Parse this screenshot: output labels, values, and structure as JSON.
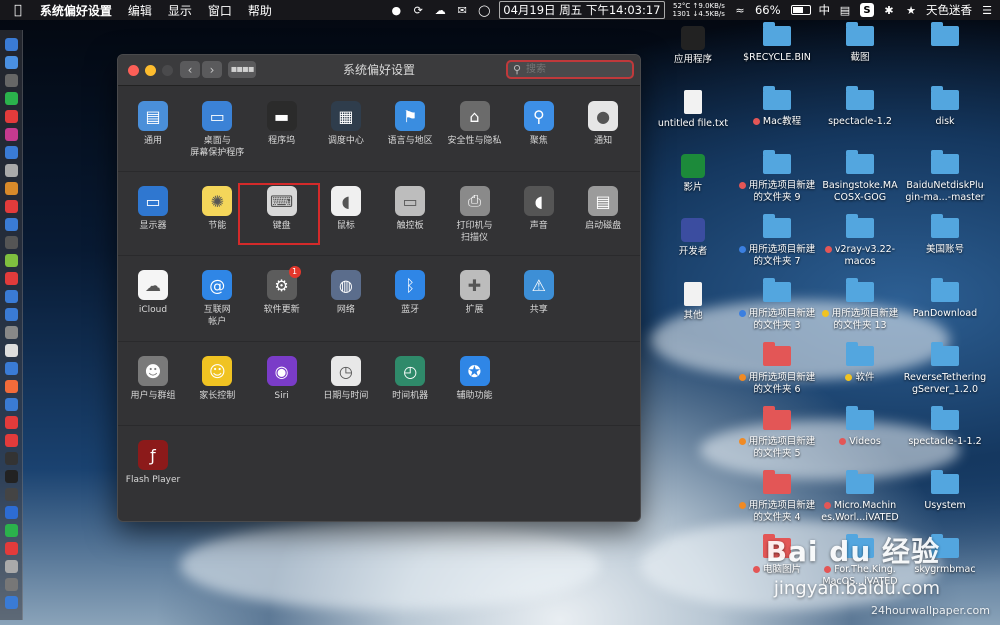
{
  "menubar": {
    "app_name": "系统偏好设置",
    "menus": [
      "编辑",
      "显示",
      "窗口",
      "帮助"
    ],
    "net_up": "52°C ↑9.0KB/s",
    "net_down": "1301 ↓4.5KB/s",
    "datetime": "04月19日 周五 下午14:03:17",
    "battery": "66%",
    "input_method": "中",
    "user": "天色迷香"
  },
  "window": {
    "title": "系统偏好设置",
    "search_placeholder": "搜索",
    "rows": [
      [
        {
          "label": "通用",
          "icon": "general-icon",
          "color": "#4a8fd9"
        },
        {
          "label": "桌面与\n屏幕保护程序",
          "icon": "desktop-icon",
          "color": "#3b82d6"
        },
        {
          "label": "程序坞",
          "icon": "dock-icon",
          "color": "#2b2b2b"
        },
        {
          "label": "调度中心",
          "icon": "mission-control-icon",
          "color": "#2f3d4c"
        },
        {
          "label": "语言与地区",
          "icon": "flag-icon",
          "color": "#3a8de0"
        },
        {
          "label": "安全性与隐私",
          "icon": "house-lock-icon",
          "color": "#6b6b6b"
        },
        {
          "label": "聚焦",
          "icon": "spotlight-icon",
          "color": "#3d8fe6"
        },
        {
          "label": "通知",
          "icon": "notifications-icon",
          "color": "#e6e6e6"
        }
      ],
      [
        {
          "label": "显示器",
          "icon": "display-icon",
          "color": "#2f77d0"
        },
        {
          "label": "节能",
          "icon": "bulb-icon",
          "color": "#f4d65a"
        },
        {
          "label": "键盘",
          "icon": "keyboard-icon",
          "color": "#d8d8d8"
        },
        {
          "label": "鼠标",
          "icon": "mouse-icon",
          "color": "#f0f0f0"
        },
        {
          "label": "触控板",
          "icon": "trackpad-icon",
          "color": "#bdbdbd"
        },
        {
          "label": "打印机与\n扫描仪",
          "icon": "printer-icon",
          "color": "#8a8a8a"
        },
        {
          "label": "声音",
          "icon": "speaker-icon",
          "color": "#555555"
        },
        {
          "label": "启动磁盘",
          "icon": "disk-icon",
          "color": "#9b9b9b"
        }
      ],
      [
        {
          "label": "iCloud",
          "icon": "icloud-icon",
          "color": "#f5f5f5"
        },
        {
          "label": "互联网\n帐户",
          "icon": "at-icon",
          "color": "#2f86e6"
        },
        {
          "label": "软件更新",
          "icon": "gear-update-icon",
          "color": "#5c5c5c",
          "badge": "1"
        },
        {
          "label": "网络",
          "icon": "network-globe-icon",
          "color": "#5b6d8c"
        },
        {
          "label": "蓝牙",
          "icon": "bluetooth-icon",
          "color": "#2f86e6"
        },
        {
          "label": "扩展",
          "icon": "puzzle-icon",
          "color": "#bcbcbc"
        },
        {
          "label": "共享",
          "icon": "sharing-folder-icon",
          "color": "#3d8fd6"
        }
      ],
      [
        {
          "label": "用户与群组",
          "icon": "users-icon",
          "color": "#7a7a7a"
        },
        {
          "label": "家长控制",
          "icon": "parental-icon",
          "color": "#f0c322"
        },
        {
          "label": "Siri",
          "icon": "siri-icon",
          "color": "#7a3cc8"
        },
        {
          "label": "日期与时间",
          "icon": "clock-calendar-icon",
          "color": "#e8e8e8"
        },
        {
          "label": "时间机器",
          "icon": "time-machine-icon",
          "color": "#2f8a6a"
        },
        {
          "label": "辅助功能",
          "icon": "accessibility-icon",
          "color": "#2f86e6"
        }
      ],
      [
        {
          "label": "Flash Player",
          "icon": "flash-icon",
          "color": "#8c1a1a"
        }
      ]
    ]
  },
  "desktop": [
    {
      "label": "应用程序",
      "kind": "app",
      "color": "#222"
    },
    {
      "label": "$RECYCLE.BIN",
      "kind": "folder"
    },
    {
      "label": "截图",
      "kind": "folder"
    },
    {
      "label": "",
      "kind": "folder"
    },
    {
      "label": "untitled file.txt",
      "kind": "file"
    },
    {
      "label": "Mac教程",
      "kind": "folder",
      "dot": "#e35656"
    },
    {
      "label": "spectacle-1.2",
      "kind": "folder"
    },
    {
      "label": "disk",
      "kind": "folder"
    },
    {
      "label": "影片",
      "kind": "app",
      "color": "#1c8a3a"
    },
    {
      "label": "用所选项目新建\n的文件夹 9",
      "kind": "folder",
      "dot": "#e35656"
    },
    {
      "label": "Basingstoke.MA\nCOSX-GOG",
      "kind": "folder"
    },
    {
      "label": "BaiduNetdiskPlu\ngin-ma...-master",
      "kind": "folder"
    },
    {
      "label": "开发者",
      "kind": "app",
      "color": "#3b4da0"
    },
    {
      "label": "用所选项目新建\n的文件夹 7",
      "kind": "folder",
      "dot": "#3b7fe0"
    },
    {
      "label": "v2ray-v3.22-\nmacos",
      "kind": "folder",
      "dot": "#e35656"
    },
    {
      "label": "美国账号",
      "kind": "folder"
    },
    {
      "label": "其他",
      "kind": "file"
    },
    {
      "label": "用所选项目新建\n的文件夹 3",
      "kind": "folder",
      "dot": "#3b7fe0"
    },
    {
      "label": "用所选项目新建\n的文件夹 13",
      "kind": "folder",
      "dot": "#f0c322"
    },
    {
      "label": "PanDownload",
      "kind": "folder"
    },
    {
      "label": "",
      "kind": "none"
    },
    {
      "label": "用所选项目新建\n的文件夹 6",
      "kind": "folder",
      "dot": "#f08a24",
      "red": true
    },
    {
      "label": "软件",
      "kind": "folder",
      "dot": "#f0c322"
    },
    {
      "label": "ReverseTethering\ngServer_1.2.0",
      "kind": "folder"
    },
    {
      "label": "",
      "kind": "none"
    },
    {
      "label": "用所选项目新建\n的文件夹 5",
      "kind": "folder",
      "dot": "#f08a24",
      "red": true
    },
    {
      "label": "Videos",
      "kind": "folder",
      "dot": "#e35656"
    },
    {
      "label": "spectacle-1-1.2",
      "kind": "folder"
    },
    {
      "label": "",
      "kind": "none"
    },
    {
      "label": "用所选项目新建\n的文件夹 4",
      "kind": "folder",
      "dot": "#f08a24",
      "red": true
    },
    {
      "label": "Micro.Machin\nes.Worl...iVATED",
      "kind": "folder",
      "dot": "#e35656"
    },
    {
      "label": "Usystem",
      "kind": "folder"
    },
    {
      "label": "",
      "kind": "none"
    },
    {
      "label": "电脑图片",
      "kind": "folder",
      "dot": "#e35656",
      "red": true
    },
    {
      "label": "For.The.King.\nMacOS...iVATED",
      "kind": "folder",
      "dot": "#e35656"
    },
    {
      "label": "skygrmbmac",
      "kind": "folder"
    }
  ],
  "watermark": {
    "brand": "Bai du 经验",
    "url": "jingyan.baidu.com",
    "site": "24hourwallpaper.com"
  }
}
